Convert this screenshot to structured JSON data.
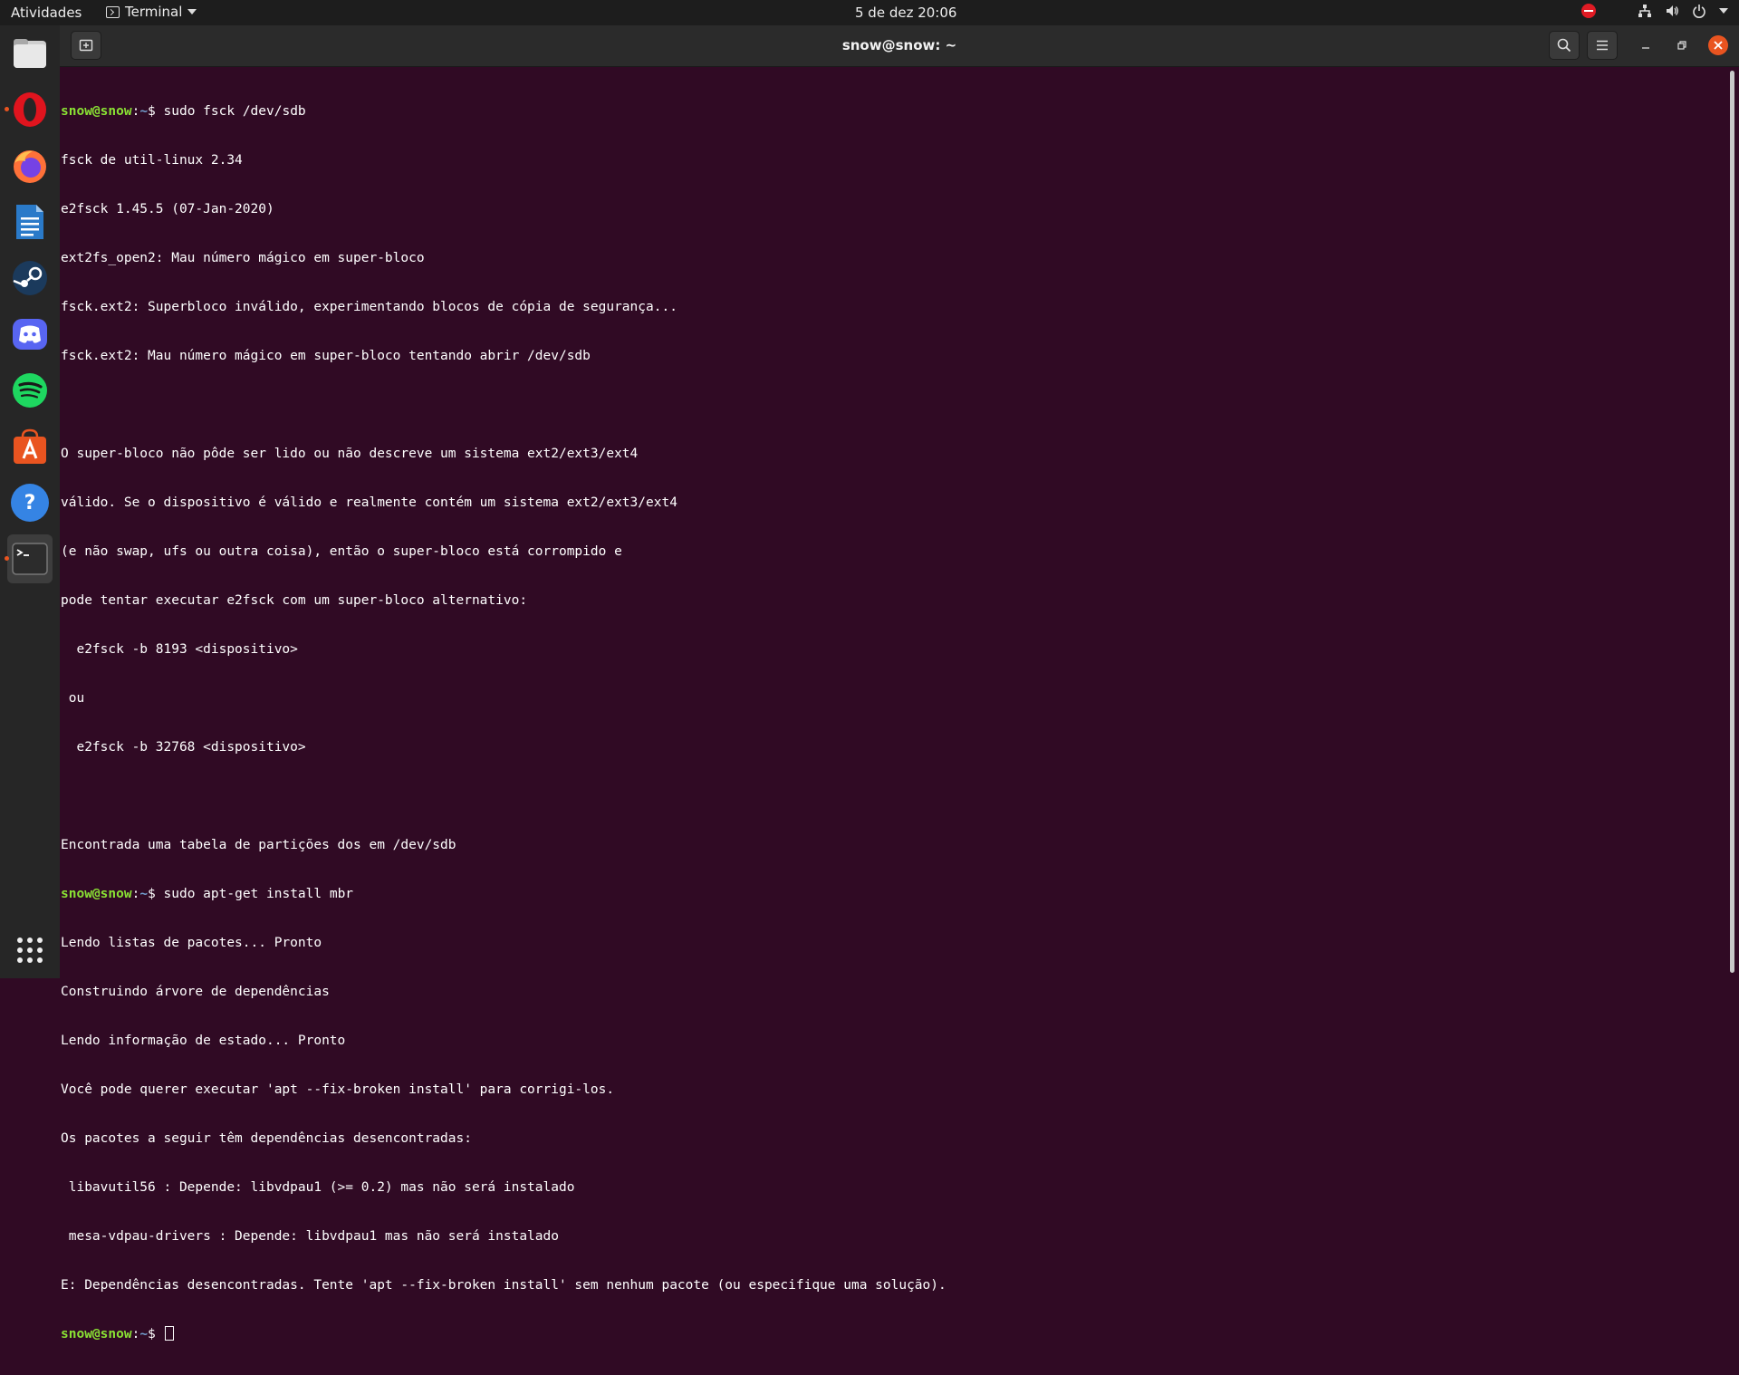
{
  "topbar": {
    "activities": "Atividades",
    "app_menu": "Terminal",
    "clock": "5 de dez  20:06"
  },
  "dock": {
    "items": [
      {
        "name": "Files",
        "icon": "files-icon"
      },
      {
        "name": "Opera",
        "icon": "opera-icon"
      },
      {
        "name": "Firefox",
        "icon": "firefox-icon"
      },
      {
        "name": "LibreOffice Writer",
        "icon": "writer-icon"
      },
      {
        "name": "Steam",
        "icon": "steam-icon"
      },
      {
        "name": "Discord",
        "icon": "discord-icon"
      },
      {
        "name": "Spotify",
        "icon": "spotify-icon"
      },
      {
        "name": "Ubuntu Software",
        "icon": "software-icon"
      },
      {
        "name": "Help",
        "icon": "help-icon"
      },
      {
        "name": "Terminal",
        "icon": "terminal-icon"
      }
    ],
    "show_apps": "grid-icon"
  },
  "window": {
    "title": "snow@snow: ~"
  },
  "terminal": {
    "prompt_user": "snow@snow",
    "prompt_sep": ":",
    "prompt_path": "~",
    "prompt_symbol": "$ ",
    "cmd1": "sudo fsck /dev/sdb",
    "out1": [
      "fsck de util-linux 2.34",
      "e2fsck 1.45.5 (07-Jan-2020)",
      "ext2fs_open2: Mau número mágico em super-bloco",
      "fsck.ext2: Superbloco inválido, experimentando blocos de cópia de segurança...",
      "fsck.ext2: Mau número mágico em super-bloco tentando abrir /dev/sdb",
      "",
      "O super-bloco não pôde ser lido ou não descreve um sistema ext2/ext3/ext4",
      "válido. Se o dispositivo é válido e realmente contém um sistema ext2/ext3/ext4",
      "(e não swap, ufs ou outra coisa), então o super-bloco está corrompido e",
      "pode tentar executar e2fsck com um super-bloco alternativo:",
      "  e2fsck -b 8193 <dispositivo>",
      " ou",
      "  e2fsck -b 32768 <dispositivo>",
      "",
      "Encontrada uma tabela de partições dos em /dev/sdb"
    ],
    "cmd2": "sudo apt-get install mbr",
    "out2": [
      "Lendo listas de pacotes... Pronto",
      "Construindo árvore de dependências",
      "Lendo informação de estado... Pronto",
      "Você pode querer executar 'apt --fix-broken install' para corrigi-los.",
      "Os pacotes a seguir têm dependências desencontradas:",
      " libavutil56 : Depende: libvdpau1 (>= 0.2) mas não será instalado",
      " mesa-vdpau-drivers : Depende: libvdpau1 mas não será instalado",
      "E: Dependências desencontradas. Tente 'apt --fix-broken install' sem nenhum pacote (ou especifique uma solução)."
    ]
  }
}
